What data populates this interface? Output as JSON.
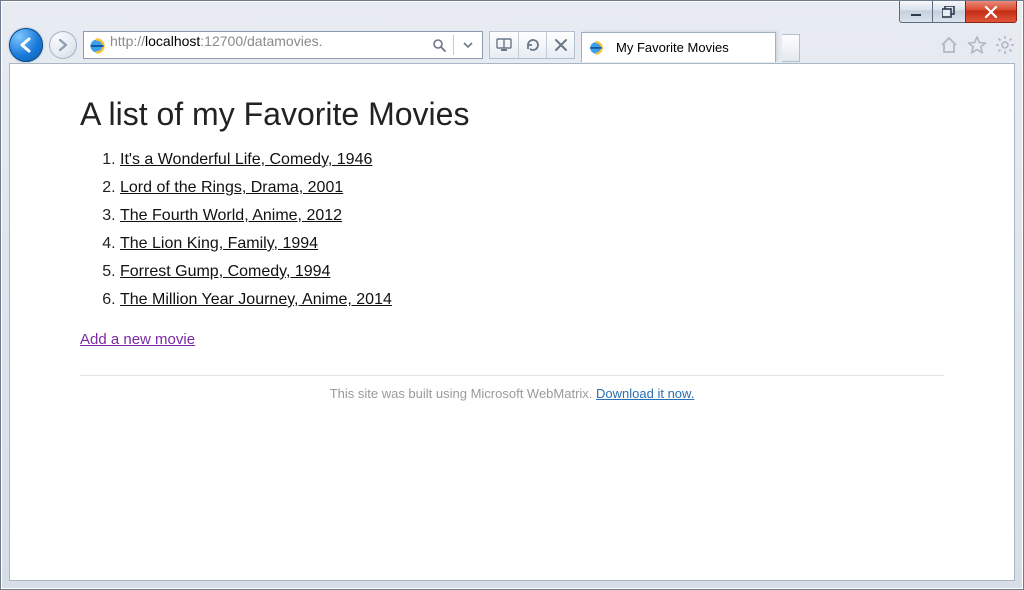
{
  "window": {
    "min_label": "Minimize",
    "max_label": "Restore",
    "close_label": "Close"
  },
  "toolbar": {
    "back_label": "Back",
    "fwd_label": "Forward",
    "url_prefix": "http://",
    "url_host": "localhost",
    "url_rest": ":12700/datamovies.",
    "search_label": "Search",
    "dropdown_label": "Dropdown",
    "compat_label": "Compatibility View",
    "refresh_label": "Refresh",
    "stop_label": "Stop",
    "newtab_label": "New tab"
  },
  "tab": {
    "title": "My Favorite Movies"
  },
  "right": {
    "home_label": "Home",
    "fav_label": "Favorites",
    "tools_label": "Tools"
  },
  "page": {
    "heading": "A list of my Favorite Movies",
    "movies": [
      "It's a Wonderful Life, Comedy, 1946",
      "Lord of the Rings, Drama, 2001",
      "The Fourth World, Anime, 2012",
      "The Lion King, Family, 1994",
      "Forrest Gump, Comedy, 1994",
      "The Million Year Journey, Anime, 2014"
    ],
    "add_link": "Add a new movie",
    "footer_text": "This site was built using Microsoft WebMatrix. ",
    "footer_link": "Download it now."
  }
}
